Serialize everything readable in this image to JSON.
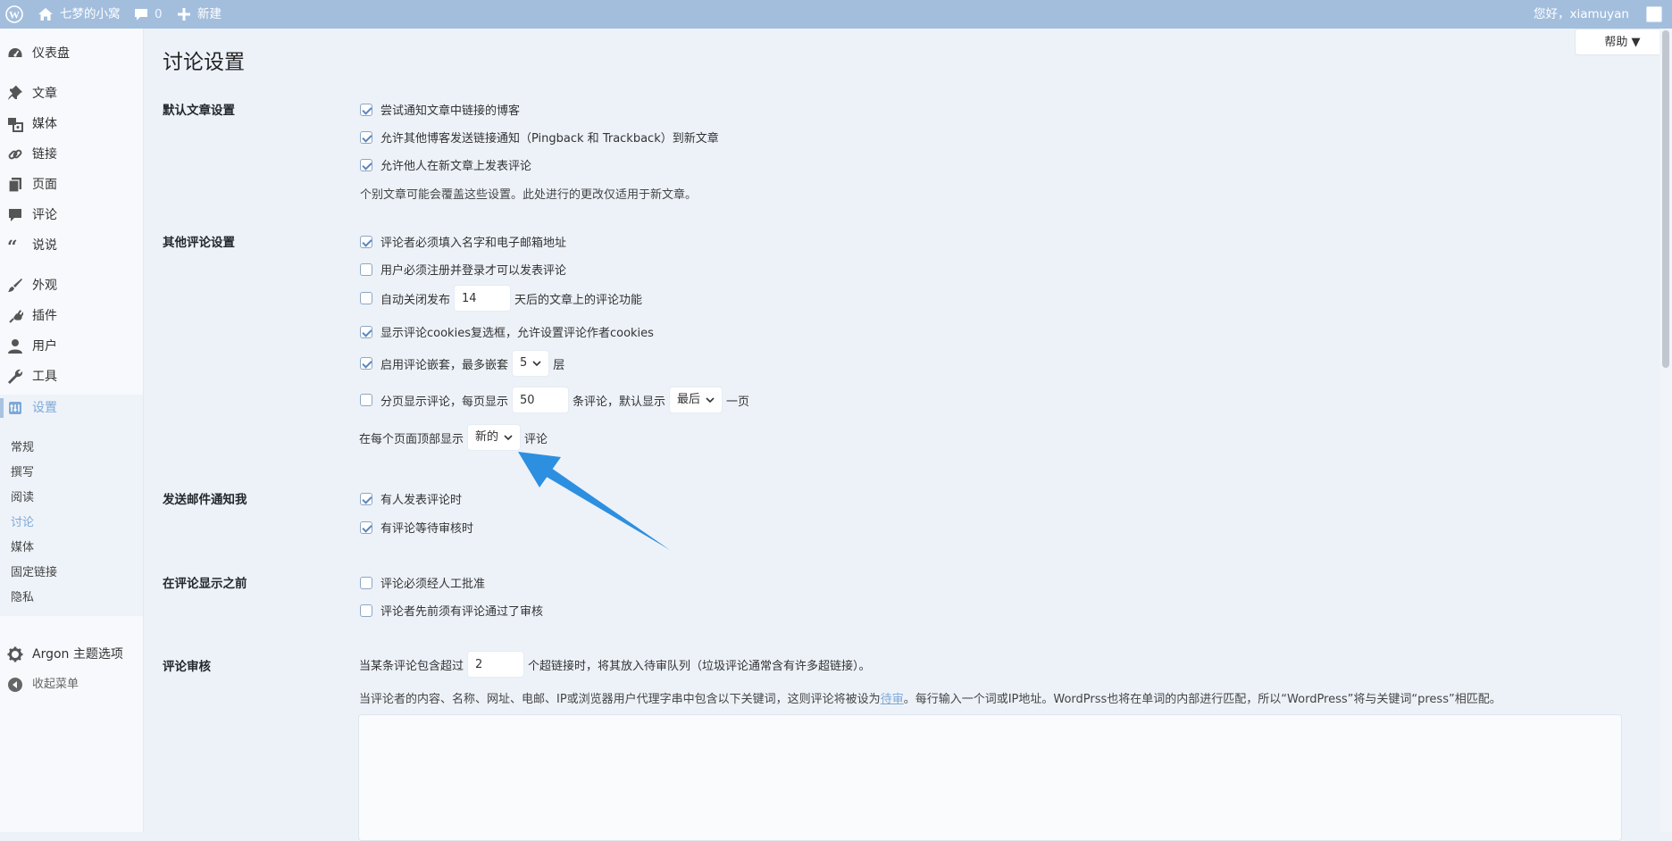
{
  "admin_bar": {
    "site_name": "七梦的小窝",
    "comment_count": "0",
    "new_label": "新建",
    "greeting": "您好，xiamuyan"
  },
  "sidebar": {
    "items": [
      {
        "label": "仪表盘",
        "icon": "dashboard-icon"
      },
      {
        "label": "文章",
        "icon": "pin-icon"
      },
      {
        "label": "媒体",
        "icon": "media-icon"
      },
      {
        "label": "链接",
        "icon": "link-icon"
      },
      {
        "label": "页面",
        "icon": "page-icon"
      },
      {
        "label": "评论",
        "icon": "comment-icon"
      },
      {
        "label": "说说",
        "icon": "quote-icon"
      },
      {
        "label": "外观",
        "icon": "brush-icon"
      },
      {
        "label": "插件",
        "icon": "plugin-icon"
      },
      {
        "label": "用户",
        "icon": "user-icon"
      },
      {
        "label": "工具",
        "icon": "wrench-icon"
      },
      {
        "label": "设置",
        "icon": "settings-icon"
      }
    ],
    "submenu": [
      "常规",
      "撰写",
      "阅读",
      "讨论",
      "媒体",
      "固定链接",
      "隐私"
    ],
    "current_submenu": "讨论",
    "argon_label": "Argon 主题选项",
    "collapse_label": "收起菜单"
  },
  "help_button": "帮助 ▼",
  "page_title": "讨论设置",
  "sections": {
    "default_post": {
      "label": "默认文章设置",
      "options": [
        {
          "label": "尝试通知文章中链接的博客",
          "checked": true
        },
        {
          "label": "允许其他博客发送链接通知（Pingback 和 Trackback）到新文章",
          "checked": true
        },
        {
          "label": "允许他人在新文章上发表评论",
          "checked": true
        }
      ],
      "note": "个别文章可能会覆盖这些设置。此处进行的更改仅适用于新文章。"
    },
    "other_comment": {
      "label": "其他评论设置",
      "opt1": "评论者必须填入名字和电子邮箱地址",
      "opt2": "用户必须注册并登录才可以发表评论",
      "opt3_pre": "自动关闭发布",
      "opt3_value": "14",
      "opt3_post": "天后的文章上的评论功能",
      "opt4": "显示评论cookies复选框，允许设置评论作者cookies",
      "opt5_pre": "启用评论嵌套，最多嵌套",
      "opt5_value": "5",
      "opt5_post": "层",
      "opt6_pre": "分页显示评论，每页显示",
      "opt6_value": "50",
      "opt6_mid": "条评论，默认显示",
      "opt6_select": "最后",
      "opt6_post": "一页",
      "opt7_pre": "在每个页面顶部显示",
      "opt7_select": "新的",
      "opt7_post": "评论"
    },
    "email_me": {
      "label": "发送邮件通知我",
      "opt1": "有人发表评论时",
      "opt2": "有评论等待审核时"
    },
    "before_appear": {
      "label": "在评论显示之前",
      "opt1": "评论必须经人工批准",
      "opt2": "评论者先前须有评论通过了审核"
    },
    "moderation": {
      "label": "评论审核",
      "line1_pre": "当某条评论包含超过",
      "line1_value": "2",
      "line1_post": "个超链接时，将其放入待审队列（垃圾评论通常含有许多超链接）。",
      "line2_pre": "当评论者的内容、名称、网址、电邮、IP或浏览器用户代理字串中包含以下关键词，这则评论将被设为",
      "line2_link": "待审",
      "line2_post": "。每行输入一个词或IP地址。WordPrss也将在单词的内部进行匹配，所以“WordPress”将与关键词“press”相匹配。"
    }
  },
  "colors": {
    "admin_bar": "#a3bedd",
    "accent": "#7fa8d6",
    "arrow": "#2d8fe0"
  }
}
